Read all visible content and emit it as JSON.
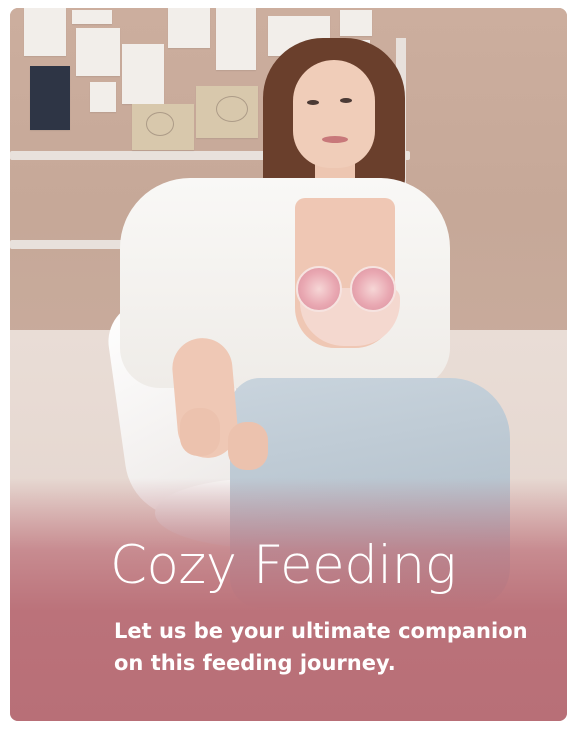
{
  "banner": {
    "headline": "Cozy Feeding",
    "subtext_line1": "Let us be your ultimate companion",
    "subtext_line2": "on this feeding journey."
  },
  "colors": {
    "overlay": "#bb727a",
    "wall": "#c8ab9c",
    "text": "#ffffff"
  }
}
